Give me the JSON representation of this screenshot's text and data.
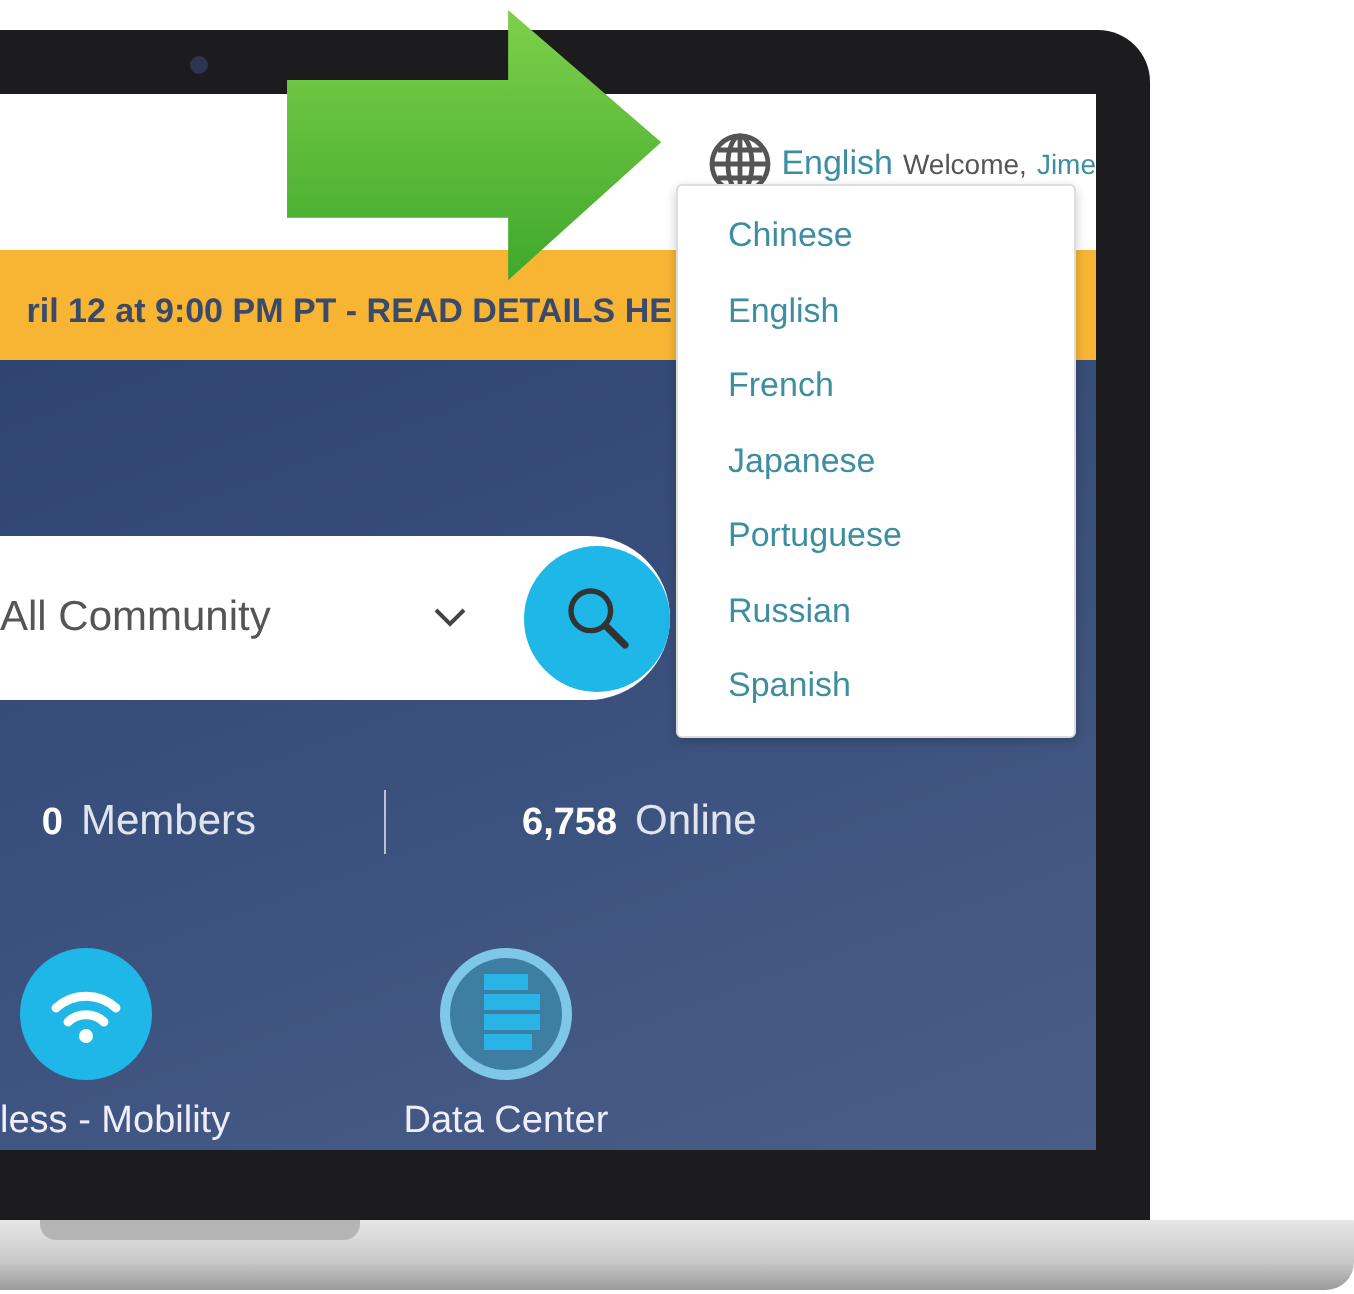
{
  "header": {
    "language": "English",
    "welcome": "Welcome,",
    "user": "Jime"
  },
  "language_menu": {
    "items": [
      "Chinese",
      "English",
      "French",
      "Japanese",
      "Portuguese",
      "Russian",
      "Spanish"
    ]
  },
  "banner": {
    "text": "ril 12 at 9:00 PM PT - READ DETAILS HE"
  },
  "search": {
    "scope": "All Community"
  },
  "stats": [
    {
      "value": "0",
      "label": "Members"
    },
    {
      "value": "6,758",
      "label": "Online"
    }
  ],
  "categories": [
    {
      "kind": "wifi",
      "label": "less - Mobility"
    },
    {
      "kind": "server",
      "label": "Data Center"
    }
  ]
}
